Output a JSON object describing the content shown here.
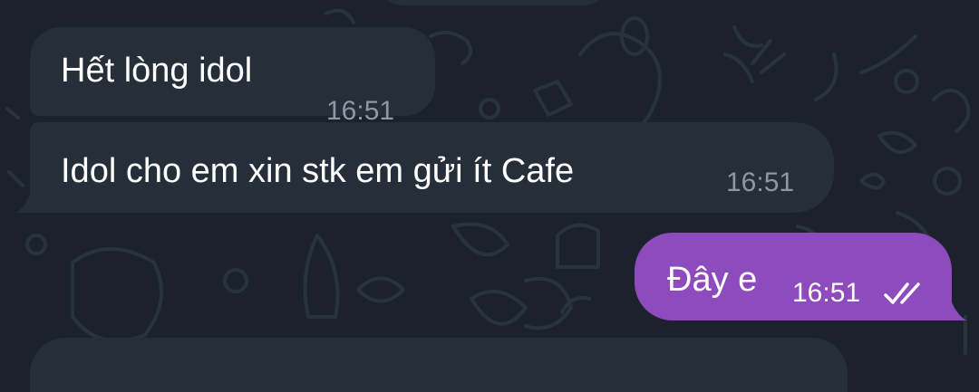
{
  "chat": {
    "messages": [
      {
        "direction": "incoming",
        "text": "Hết lòng idol",
        "time": "16:51"
      },
      {
        "direction": "incoming",
        "text": "Idol cho em xin stk em gửi ít Cafe",
        "time": "16:51"
      },
      {
        "direction": "outgoing",
        "text": "Đây e",
        "time": "16:51",
        "status_icon": "double-check-icon"
      }
    ]
  },
  "colors": {
    "background": "#1b222b",
    "incoming_bubble": "#262f39",
    "outgoing_bubble": "#8e4bbd",
    "incoming_time": "#8d98a4",
    "text": "#ffffff"
  }
}
